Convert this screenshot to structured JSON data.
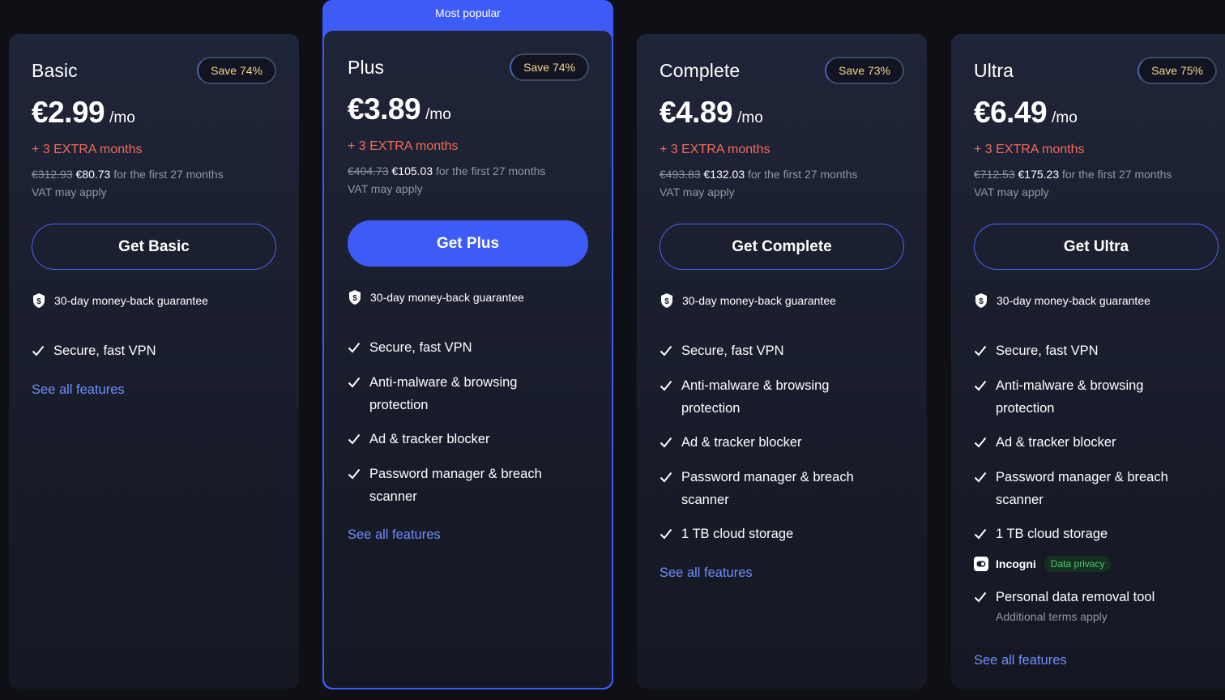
{
  "popular_label": "Most popular",
  "guarantee": "30-day money-back guarantee",
  "see_all": "See all features",
  "incogni": {
    "name": "Incogni",
    "badge": "Data privacy"
  },
  "plans": [
    {
      "name": "Basic",
      "save": "Save 74%",
      "price": "€2.99",
      "per": "/mo",
      "extra": "+ 3 EXTRA months",
      "old_price": "€312.93",
      "new_price": "€80.73",
      "period": "for the first 27 months",
      "vat": "VAT may apply",
      "cta": "Get Basic",
      "features": [
        "Secure, fast VPN"
      ]
    },
    {
      "name": "Plus",
      "save": "Save 74%",
      "price": "€3.89",
      "per": "/mo",
      "extra": "+ 3 EXTRA months",
      "old_price": "€404.73",
      "new_price": "€105.03",
      "period": "for the first 27 months",
      "vat": "VAT may apply",
      "cta": "Get Plus",
      "features": [
        "Secure, fast VPN",
        "Anti-malware & browsing protection",
        "Ad & tracker blocker",
        "Password manager & breach scanner"
      ]
    },
    {
      "name": "Complete",
      "save": "Save 73%",
      "price": "€4.89",
      "per": "/mo",
      "extra": "+ 3 EXTRA months",
      "old_price": "€493.83",
      "new_price": "€132.03",
      "period": "for the first 27 months",
      "vat": "VAT may apply",
      "cta": "Get Complete",
      "features": [
        "Secure, fast VPN",
        "Anti-malware & browsing protection",
        "Ad & tracker blocker",
        "Password manager & breach scanner",
        "1 TB cloud storage"
      ]
    },
    {
      "name": "Ultra",
      "save": "Save 75%",
      "price": "€6.49",
      "per": "/mo",
      "extra": "+ 3 EXTRA months",
      "old_price": "€712.53",
      "new_price": "€175.23",
      "period": "for the first 27 months",
      "vat": "VAT may apply",
      "cta": "Get Ultra",
      "features": [
        "Secure, fast VPN",
        "Anti-malware & browsing protection",
        "Ad & tracker blocker",
        "Password manager & breach scanner",
        "1 TB cloud storage"
      ],
      "extra_feature": "Personal data removal tool",
      "extra_note": "Additional terms apply"
    }
  ],
  "colors": {
    "accent": "#3d5bf6",
    "extra": "#f26b5b",
    "badge_text": "#f4d58d",
    "link": "#6f8dff",
    "privacy_green": "#4cc77a"
  },
  "icons": {
    "guarantee": "shield-dollar-icon",
    "feature": "check-icon",
    "incogni": "incogni-logo-icon"
  }
}
